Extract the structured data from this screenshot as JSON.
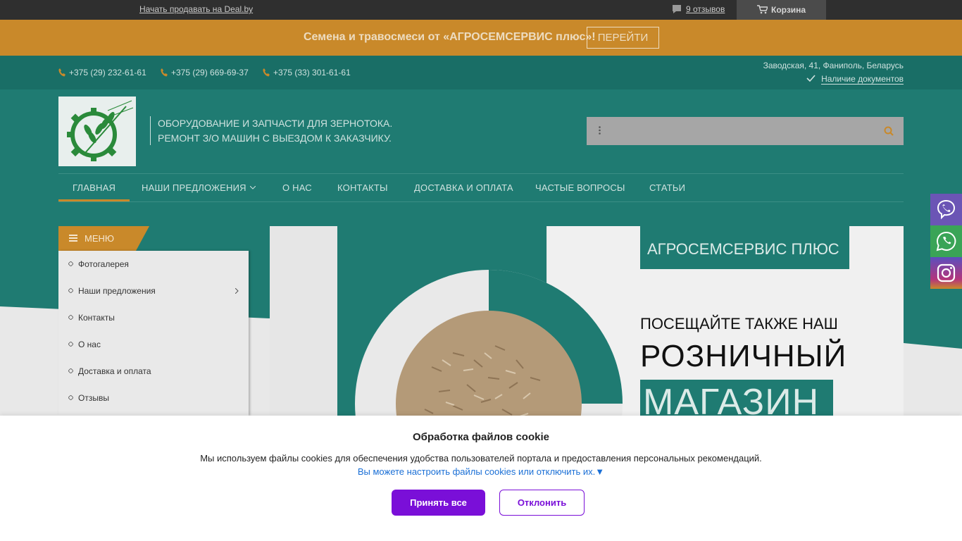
{
  "topbar": {
    "sell_link": "Начать продавать на Deal.by",
    "reviews_link": "9 отзывов",
    "cart_label": "Корзина"
  },
  "promo": {
    "text": "Семена и травосмеси от «АГРОСЕМСЕРВИС плюс»!",
    "button": "ПЕРЕЙТИ"
  },
  "contacts": {
    "phones": [
      "+375 (29) 232-61-61",
      "+375 (29) 669-69-37",
      "+375 (33) 301-61-61"
    ],
    "address": "Заводская, 41, Фаниполь, Беларусь",
    "docs_link": "Наличие документов"
  },
  "header": {
    "tagline_line1": "ОБОРУДОВАНИЕ И ЗАПЧАСТИ ДЛЯ ЗЕРНОТОКА.",
    "tagline_line2": "РЕМОНТ З/О МАШИН С ВЫЕЗДОМ К ЗАКАЗЧИКУ.",
    "search_placeholder": ""
  },
  "nav": {
    "items": [
      "ГЛАВНАЯ",
      "НАШИ ПРЕДЛОЖЕНИЯ",
      "О НАС",
      "КОНТАКТЫ",
      "ДОСТАВКА И ОПЛАТА",
      "ЧАСТЫЕ ВОПРОСЫ",
      "СТАТЬИ"
    ]
  },
  "sidebar": {
    "title": "МЕНЮ",
    "items": [
      "Фотогалерея",
      "Наши предложения",
      "Контакты",
      "О нас",
      "Доставка и оплата",
      "Отзывы"
    ]
  },
  "slider": {
    "brand": "АГРОСЕМСЕРВИС ПЛЮС",
    "line1": "ПОСЕЩАЙТЕ ТАКЖЕ НАШ",
    "line2": "РОЗНИЧНЫЙ",
    "line3": "МАГАЗИН"
  },
  "messengers": [
    "viber-icon",
    "whatsapp-icon",
    "instagram-icon"
  ],
  "cookie": {
    "title": "Обработка файлов cookie",
    "description": "Мы используем файлы cookies для обеспечения удобства пользователей портала и предоставления персональных рекомендаций.",
    "configure_link": "Вы можете настроить файлы cookies или отключить их.▼",
    "accept": "Принять все",
    "reject": "Отклонить"
  },
  "colors": {
    "teal": "#1f7b72",
    "orange": "#c9892a",
    "purple": "#7a0fd8"
  }
}
